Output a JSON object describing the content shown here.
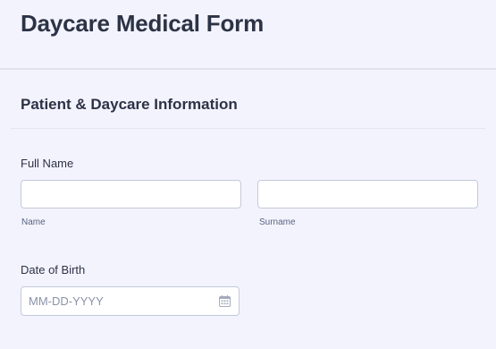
{
  "form": {
    "title": "Daycare Medical Form"
  },
  "section": {
    "title": "Patient & Daycare Information"
  },
  "full_name": {
    "label": "Full Name",
    "first": {
      "value": "",
      "sublabel": "Name"
    },
    "last": {
      "value": "",
      "sublabel": "Surname"
    }
  },
  "dob": {
    "label": "Date of Birth",
    "placeholder": "MM-DD-YYYY",
    "value": "",
    "icon": "calendar-icon"
  },
  "colors": {
    "background": "#f3f3fe",
    "text": "#2c3345",
    "input_border": "#c3cad8",
    "sublabel": "#57647e",
    "placeholder": "#8a93a8"
  }
}
